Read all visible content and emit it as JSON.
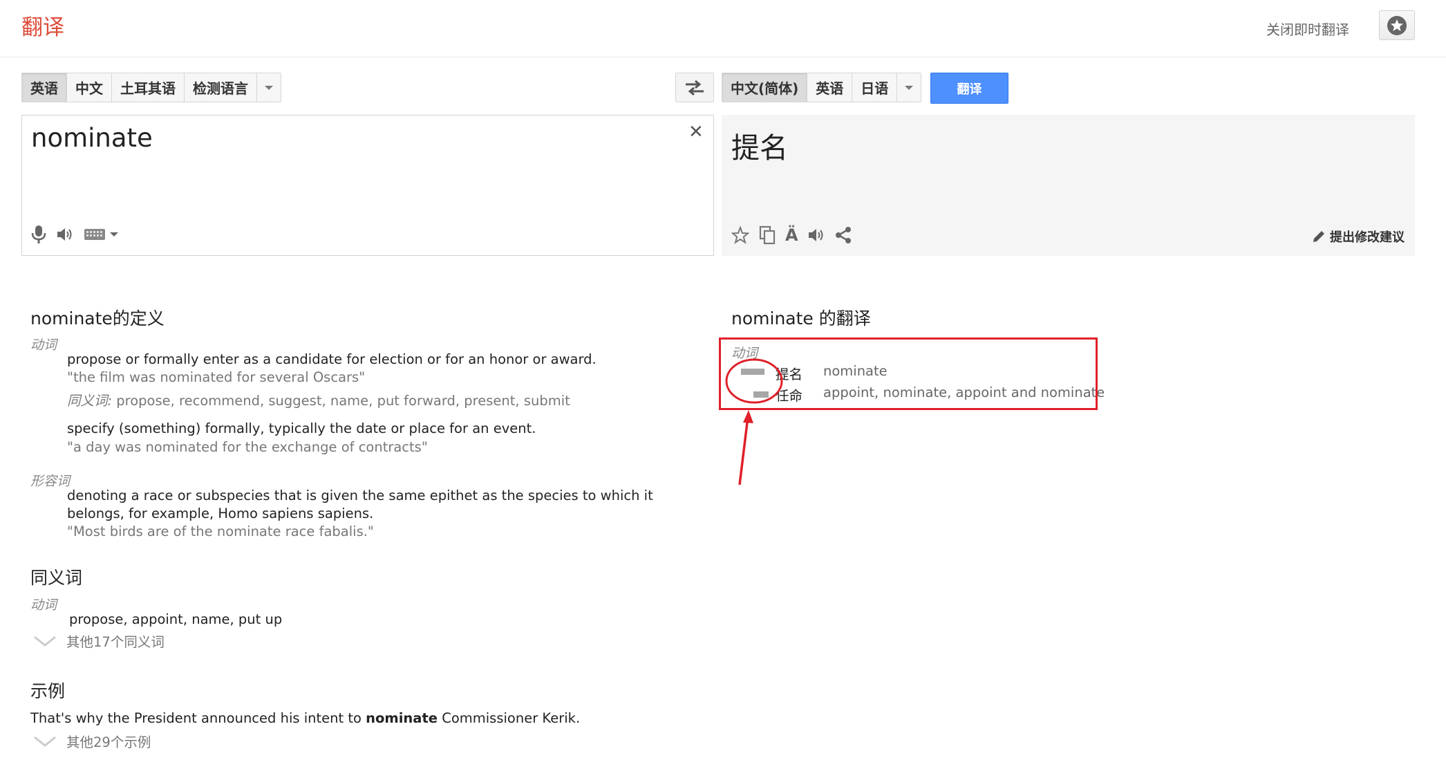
{
  "header": {
    "app_title": "翻译",
    "instant_toggle": "关闭即时翻译"
  },
  "source_langs": {
    "items": [
      "英语",
      "中文",
      "土耳其语",
      "检测语言"
    ],
    "selected": 0
  },
  "target_langs": {
    "items": [
      "中文(简体)",
      "英语",
      "日语"
    ],
    "selected": 0
  },
  "translate_button": "翻译",
  "source": {
    "text": "nominate"
  },
  "result": {
    "text": "提名",
    "suggest_edit": "提出修改建议"
  },
  "definitions": {
    "title": "nominate的定义",
    "verb_label": "动词",
    "verb_defs": [
      {
        "text": "propose or formally enter as a candidate for election or for an honor or award.",
        "example": "\"the film was nominated for several Oscars\"",
        "syn_label": "同义词:",
        "synonyms": " propose, recommend, suggest, name, put forward, present, submit"
      },
      {
        "text": "specify (something) formally, typically the date or place for an event.",
        "example": "\"a day was nominated for the exchange of contracts\""
      }
    ],
    "adj_label": "形容词",
    "adj_def": {
      "text": "denoting a race or subspecies that is given the same epithet as the species to which it belongs, for example, Homo sapiens sapiens.",
      "example": "\"Most birds are of the nominate race fabalis.\""
    }
  },
  "synonyms": {
    "title": "同义词",
    "pos": "动词",
    "list": "propose, appoint, name, put up",
    "more": "其他17个同义词"
  },
  "examples": {
    "title": "示例",
    "sentence_before": "That's why the President announced his intent to ",
    "sentence_bold": "nominate",
    "sentence_after": " Commissioner Kerik.",
    "more": "其他29个示例"
  },
  "translations": {
    "title": "nominate 的翻译",
    "pos": "动词",
    "rows": [
      {
        "word": "提名",
        "back": "nominate",
        "frequency": 0.85
      },
      {
        "word": "任命",
        "back": "appoint, nominate, appoint and nominate",
        "frequency": 0.55
      }
    ]
  },
  "colors": {
    "brand_red": "#dd4b39",
    "button_blue": "#4d90fe",
    "annotation_red": "#e0202a"
  }
}
